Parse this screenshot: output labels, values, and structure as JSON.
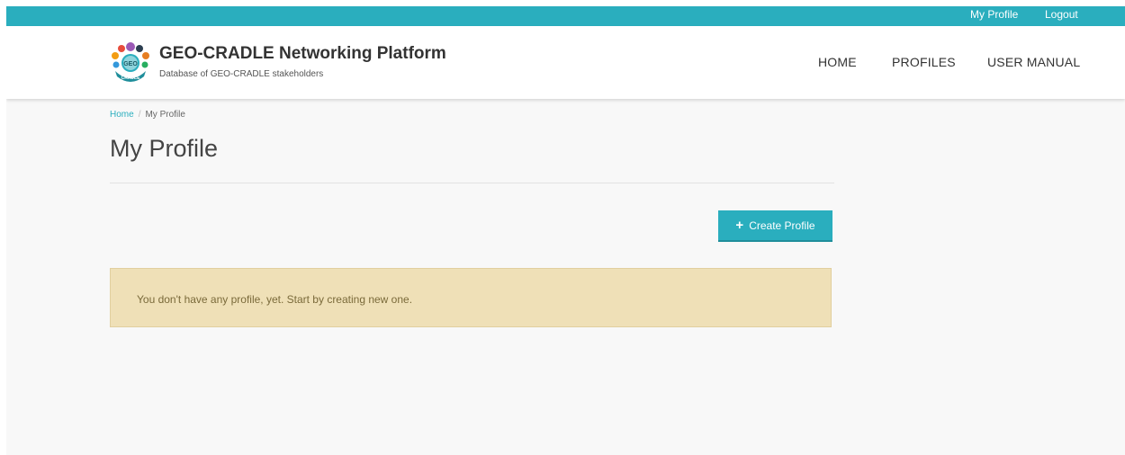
{
  "topbar": {
    "my_profile": "My Profile",
    "logout": "Logout"
  },
  "header": {
    "title": "GEO-CRADLE Networking Platform",
    "subtitle": "Database of GEO-CRADLE stakeholders",
    "logo_text": "GEO",
    "logo_ring_text": "CRADLE"
  },
  "nav": {
    "home": "HOME",
    "profiles": "PROFILES",
    "user_manual": "USER MANUAL"
  },
  "breadcrumb": {
    "home": "Home",
    "separator": "/",
    "current": "My Profile"
  },
  "page": {
    "title": "My Profile"
  },
  "actions": {
    "create_profile": "Create Profile",
    "create_icon": "+"
  },
  "alert": {
    "message": "You don't have any profile, yet. Start by creating new one."
  },
  "colors": {
    "accent": "#2aaebe",
    "alert_bg": "#efe0b7",
    "alert_text": "#7a6a3a"
  }
}
